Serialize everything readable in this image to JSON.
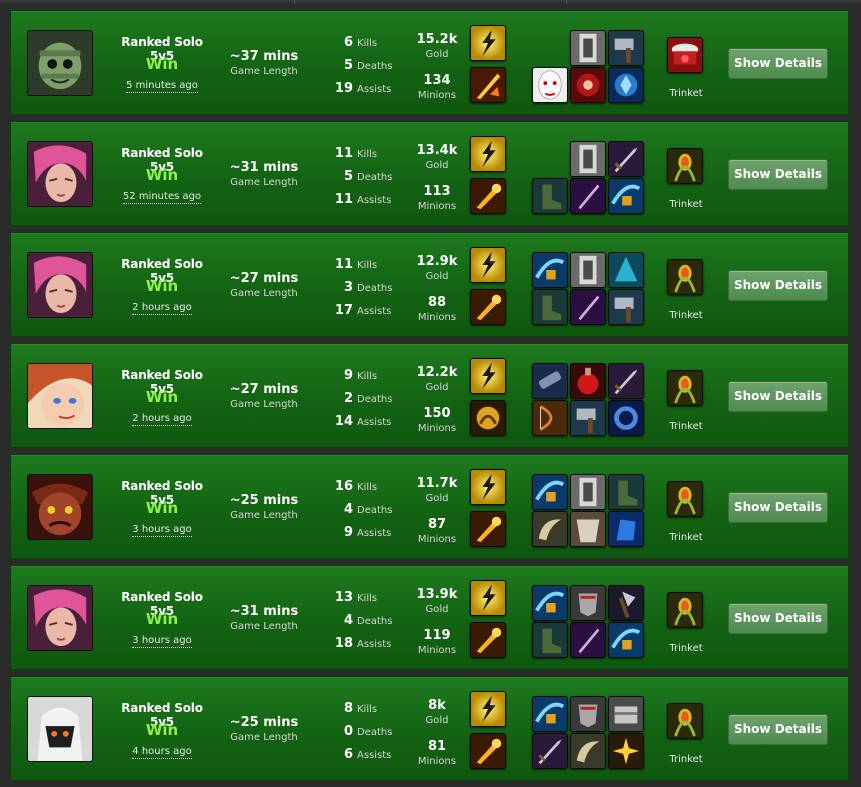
{
  "colors": {
    "card_bg": "#136313",
    "win_text": "#8ef04a",
    "button_bg": "#5f965f",
    "page_bg": "#2b2b2b"
  },
  "labels": {
    "kills": "Kills",
    "deaths": "Deaths",
    "assists": "Assists",
    "gold": "Gold",
    "minions": "Minions",
    "game_length": "Game Length",
    "trinket": "Trinket",
    "show_details": "Show Details"
  },
  "matches": [
    {
      "champion_icon": "amumu-portrait",
      "queue": "Ranked Solo 5v5",
      "result": "Win",
      "time_ago": "5 minutes ago",
      "length": "~37 mins",
      "kills": "6",
      "deaths": "5",
      "assists": "19",
      "gold": "15.2k",
      "minions": "134",
      "spells": [
        "flash-spell-icon",
        "ignite-spell-icon"
      ],
      "items": [
        "empty",
        "frozen-heart-icon",
        "hammer-item-icon",
        "mask-item-icon",
        "sunfire-cape-icon",
        "crystal-item-icon"
      ],
      "trinket": "oracles-lens-icon"
    },
    {
      "champion_icon": "vi-portrait",
      "queue": "Ranked Solo 5v5",
      "result": "Win",
      "time_ago": "52 minutes ago",
      "length": "~31 mins",
      "kills": "11",
      "deaths": "5",
      "assists": "11",
      "gold": "13.4k",
      "minions": "113",
      "spells": [
        "flash-spell-icon",
        "smite-spell-icon"
      ],
      "items": [
        "empty",
        "frozen-heart-icon",
        "sword-item-icon",
        "boots-item-icon",
        "blade-item-icon",
        "jungle-item-icon"
      ],
      "trinket": "warding-totem-icon"
    },
    {
      "champion_icon": "vi-portrait",
      "queue": "Ranked Solo 5v5",
      "result": "Win",
      "time_ago": "2 hours ago",
      "length": "~27 mins",
      "kills": "11",
      "deaths": "3",
      "assists": "17",
      "gold": "12.9k",
      "minions": "88",
      "spells": [
        "flash-spell-icon",
        "smite-spell-icon"
      ],
      "items": [
        "jungle-item-icon",
        "frozen-heart-icon",
        "cloak-item-icon",
        "boots-item-icon",
        "blade-item-icon",
        "hammer-item-icon"
      ],
      "trinket": "warding-totem-icon"
    },
    {
      "champion_icon": "miss-fortune-portrait",
      "queue": "Ranked Solo 5v5",
      "result": "Win",
      "time_ago": "2 hours ago",
      "length": "~27 mins",
      "kills": "9",
      "deaths": "2",
      "assists": "14",
      "gold": "12.2k",
      "minions": "150",
      "spells": [
        "flash-spell-icon",
        "heal-spell-icon"
      ],
      "items": [
        "cannon-item-icon",
        "potion-item-icon",
        "sword-item-icon",
        "bow-item-icon",
        "hammer-item-icon",
        "ring-item-icon"
      ],
      "trinket": "warding-totem-icon"
    },
    {
      "champion_icon": "wukong-portrait",
      "queue": "Ranked Solo 5v5",
      "result": "Win",
      "time_ago": "3 hours ago",
      "length": "~25 mins",
      "kills": "16",
      "deaths": "4",
      "assists": "9",
      "gold": "11.7k",
      "minions": "87",
      "spells": [
        "flash-spell-icon",
        "smite-spell-icon"
      ],
      "items": [
        "jungle-item-icon",
        "frozen-heart-icon",
        "boots-item-icon",
        "horn-item-icon",
        "armor-item-icon",
        "gauntlet-item-icon"
      ],
      "trinket": "warding-totem-icon"
    },
    {
      "champion_icon": "vi-portrait",
      "queue": "Ranked Solo 5v5",
      "result": "Win",
      "time_ago": "3 hours ago",
      "length": "~31 mins",
      "kills": "13",
      "deaths": "4",
      "assists": "18",
      "gold": "13.9k",
      "minions": "119",
      "spells": [
        "flash-spell-icon",
        "smite-spell-icon"
      ],
      "items": [
        "jungle-item-icon",
        "shield-item-icon",
        "axe-item-icon",
        "boots-item-icon",
        "blade-item-icon",
        "jungle-item-icon"
      ],
      "trinket": "warding-totem-icon"
    },
    {
      "champion_icon": "jax-portrait",
      "queue": "Ranked Solo 5v5",
      "result": "Win",
      "time_ago": "4 hours ago",
      "length": "~25 mins",
      "kills": "8",
      "deaths": "0",
      "assists": "6",
      "gold": "8k",
      "minions": "81",
      "spells": [
        "flash-spell-icon",
        "smite-spell-icon"
      ],
      "items": [
        "jungle-item-icon",
        "shield-item-icon",
        "chest-item-icon",
        "sword-item-icon",
        "horn-item-icon",
        "spark-item-icon"
      ],
      "trinket": "warding-totem-icon"
    }
  ]
}
